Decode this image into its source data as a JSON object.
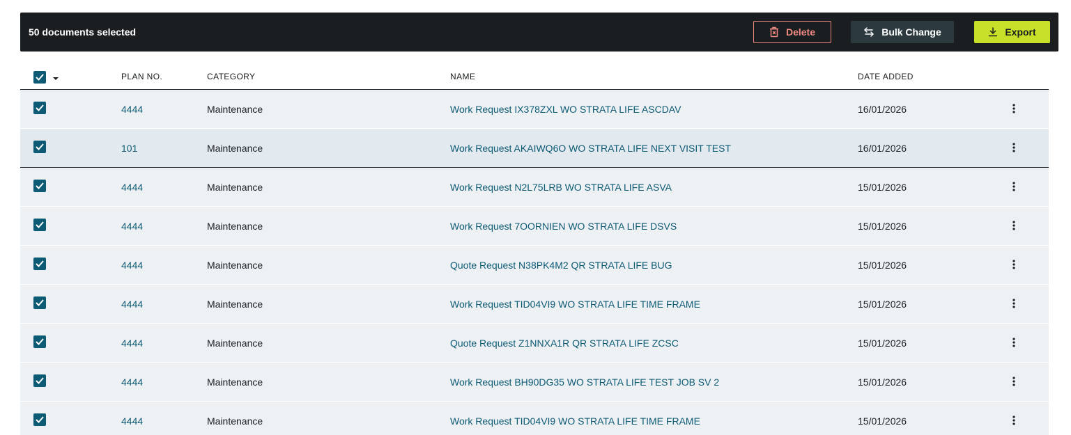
{
  "toolbar": {
    "selection_label": "50 documents selected",
    "delete_label": "Delete",
    "bulk_change_label": "Bulk Change",
    "export_label": "Export"
  },
  "colors": {
    "toolbar_bg": "#1b1e20",
    "delete_accent": "#f08a82",
    "bulk_bg": "#2c3a40",
    "export_bg": "#c9e02a",
    "link": "#0d5a75",
    "row_bg": "#edf1f4",
    "checkbox": "#0d5a75"
  },
  "icons": {
    "delete": "trash-x-icon",
    "bulk_change": "swap-arrows-icon",
    "export": "download-icon",
    "row_menu": "kebab-menu-icon",
    "select_all_menu": "caret-down-icon",
    "checkbox": "checkmark-icon"
  },
  "table": {
    "columns": {
      "plan": "PLAN NO.",
      "category": "CATEGORY",
      "name": "NAME",
      "date": "DATE ADDED"
    },
    "select_all_checked": true,
    "rows": [
      {
        "plan": "4444",
        "category": "Maintenance",
        "name": "Work Request IX378ZXL WO STRATA LIFE ASCDAV",
        "date": "16/01/2026",
        "checked": true
      },
      {
        "plan": "101",
        "category": "Maintenance",
        "name": "Work Request AKAIWQ6O WO STRATA LIFE NEXT VISIT TEST",
        "date": "16/01/2026",
        "checked": true
      },
      {
        "plan": "4444",
        "category": "Maintenance",
        "name": "Work Request N2L75LRB WO STRATA LIFE ASVA",
        "date": "15/01/2026",
        "checked": true
      },
      {
        "plan": "4444",
        "category": "Maintenance",
        "name": "Work Request 7OORNIEN WO STRATA LIFE DSVS",
        "date": "15/01/2026",
        "checked": true
      },
      {
        "plan": "4444",
        "category": "Maintenance",
        "name": "Quote Request N38PK4M2 QR STRATA LIFE BUG",
        "date": "15/01/2026",
        "checked": true
      },
      {
        "plan": "4444",
        "category": "Maintenance",
        "name": "Work Request TID04VI9 WO STRATA LIFE TIME FRAME",
        "date": "15/01/2026",
        "checked": true
      },
      {
        "plan": "4444",
        "category": "Maintenance",
        "name": "Quote Request Z1NNXA1R QR STRATA LIFE ZCSC",
        "date": "15/01/2026",
        "checked": true
      },
      {
        "plan": "4444",
        "category": "Maintenance",
        "name": "Work Request BH90DG35 WO STRATA LIFE TEST JOB SV 2",
        "date": "15/01/2026",
        "checked": true
      },
      {
        "plan": "4444",
        "category": "Maintenance",
        "name": "Work Request TID04VI9 WO STRATA LIFE TIME FRAME",
        "date": "15/01/2026",
        "checked": true
      }
    ]
  }
}
